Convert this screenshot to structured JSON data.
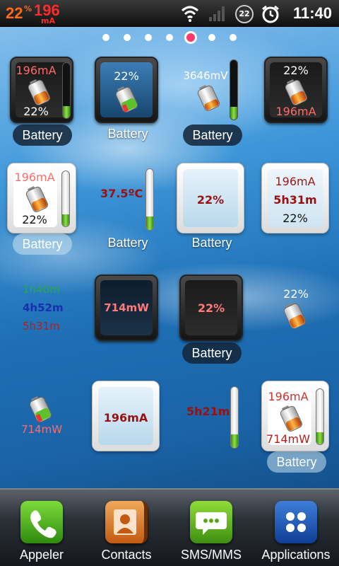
{
  "status_bar": {
    "battery_percent": "22",
    "percent_sign": "%",
    "current_value": "196",
    "current_unit": "mA",
    "notification_count": "22",
    "time": "11:40"
  },
  "page_indicator": {
    "pages": 7,
    "active": 5
  },
  "widgets": {
    "r1c1": {
      "top": "196mA",
      "bottom": "22%",
      "label": "Battery",
      "level": 0.22
    },
    "r1c2": {
      "top": "22%",
      "label": "Battery"
    },
    "r1c3": {
      "top": "3646mV",
      "label": "Battery",
      "level": 0.22
    },
    "r1c4": {
      "top": "22%",
      "bottom": "196mA"
    },
    "r2c1": {
      "top": "196mA",
      "bottom": "22%",
      "label": "Battery",
      "level": 0.22
    },
    "r2c2": {
      "value": "37.5ºC",
      "label": "Battery",
      "level": 0.22
    },
    "r2c3": {
      "value": "22%",
      "label": "Battery"
    },
    "r2c4": {
      "line1": "196mA",
      "line2": "5h31m",
      "line3": "22%"
    },
    "r3c1": {
      "line1": "1h40m",
      "line2": "4h52m",
      "line3": "5h31m"
    },
    "r3c2": {
      "value": "714mW"
    },
    "r3c3": {
      "value": "22%",
      "label": "Battery"
    },
    "r3c4": {
      "top": "22%"
    },
    "r4c1": {
      "bottom": "714mW"
    },
    "r4c2": {
      "value": "196mA"
    },
    "r4c3": {
      "value": "5h21m",
      "level": 0.22
    },
    "r4c4": {
      "top": "196mA",
      "bottom": "714mW",
      "label": "Battery",
      "level": 0.22
    }
  },
  "dock": {
    "items": [
      {
        "label": "Appeler"
      },
      {
        "label": "Contacts"
      },
      {
        "label": "SMS/MMS"
      },
      {
        "label": "Applications"
      }
    ]
  },
  "colors": {
    "accent_red": "#ff6b6b",
    "level_green": "#6cc82a",
    "status_orange": "#ff6a1a"
  }
}
